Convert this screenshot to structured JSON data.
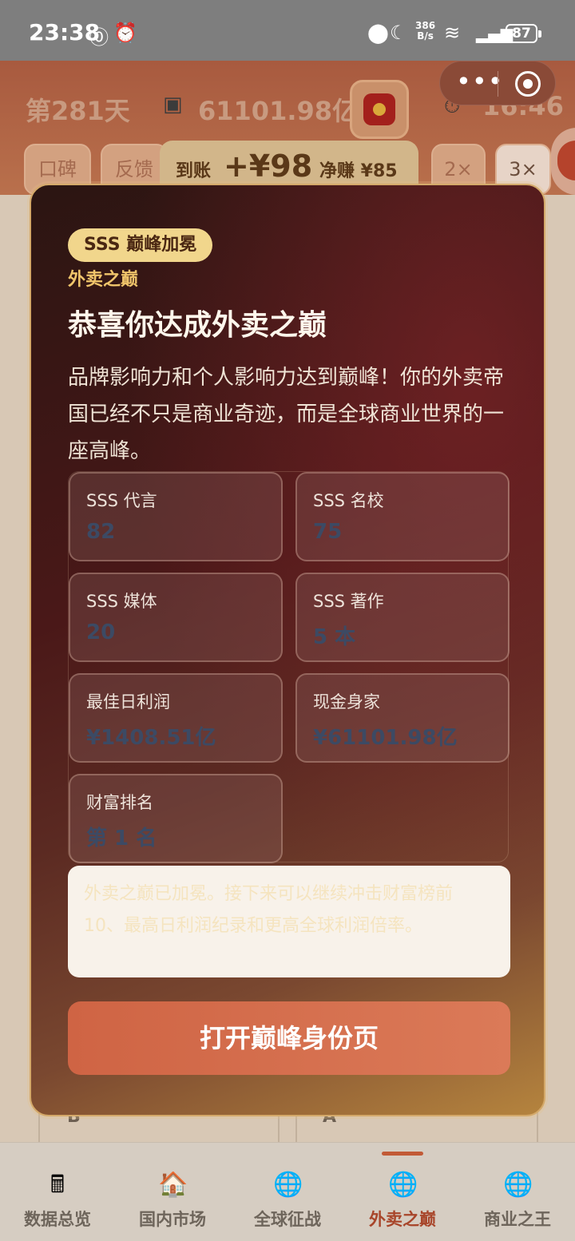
{
  "status_bar": {
    "time": "23:38",
    "net_speed_value": "386",
    "net_speed_unit": "B/s",
    "battery": "87"
  },
  "header": {
    "day": "第281天",
    "money": "61101.98亿",
    "clock": "16:46",
    "tabs": [
      "口碑",
      "反馈",
      "2×",
      "3×"
    ],
    "income": {
      "label": "到账",
      "amount": "+¥98",
      "net": "净赚 ¥85"
    }
  },
  "modal": {
    "badge": "SSS 巅峰加冕",
    "kicker": "外卖之巅",
    "title": "恭喜你达成外卖之巅",
    "description": "品牌影响力和个人影响力达到巅峰！你的外卖帝国已经不只是商业奇迹，而是全球商业世界的一座高峰。",
    "stats": [
      {
        "label": "SSS 代言",
        "value": "82"
      },
      {
        "label": "SSS 名校",
        "value": "75"
      },
      {
        "label": "SSS 媒体",
        "value": "20"
      },
      {
        "label": "SSS 著作",
        "value": "5 本"
      },
      {
        "label": "最佳日利润",
        "value": "¥1408.51亿"
      },
      {
        "label": "现金身家",
        "value": "¥61101.98亿"
      },
      {
        "label": "财富排名",
        "value": "第 1 名"
      }
    ],
    "notice": "外卖之巅已加冕。接下来可以继续冲击财富榜前 10、最高日利润纪录和更高全球利润倍率。",
    "cta": "打开巅峰身份页"
  },
  "background": {
    "letters": [
      "B",
      "A"
    ]
  },
  "bottom_nav": {
    "items": [
      {
        "label": "数据总览",
        "icon": "cash-register-icon"
      },
      {
        "label": "国内市场",
        "icon": "storefront-icon"
      },
      {
        "label": "全球征战",
        "icon": "globe-icon"
      },
      {
        "label": "外卖之巅",
        "icon": "globe-icon"
      },
      {
        "label": "商业之王",
        "icon": "globe-icon"
      }
    ],
    "active_index": 3
  }
}
